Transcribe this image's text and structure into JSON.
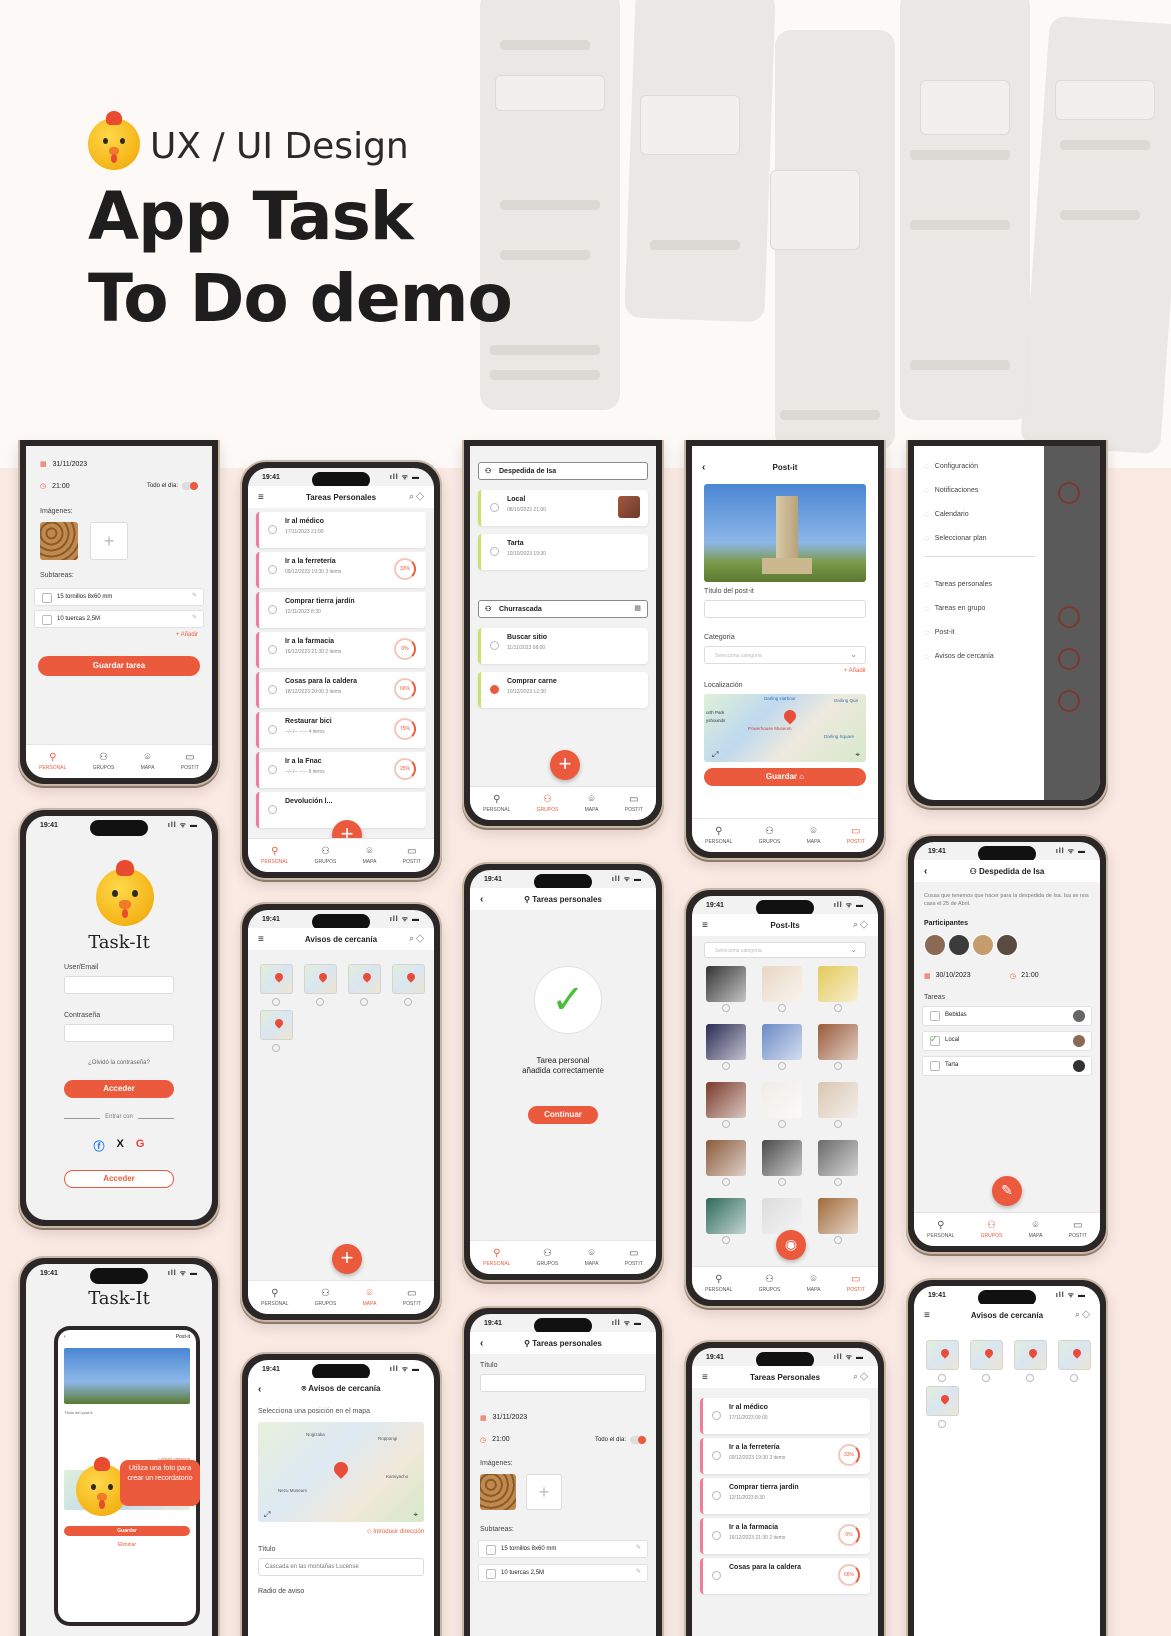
{
  "hero": {
    "subtitle": "UX / UI Design",
    "title_line1": "App Task",
    "title_line2": "To Do demo"
  },
  "status": {
    "time": "19:41",
    "icons": "ıll ᯤ ▬"
  },
  "nav": {
    "personal": "PERSONAL",
    "grupos": "GRUPOS",
    "mapa": "MAPA",
    "postit": "POSTIT"
  },
  "p1": {
    "date": "31/11/2023",
    "time": "21:00",
    "allday": "Todo el día:",
    "images_label": "Imágenes:",
    "subtasks_label": "Subtareas:",
    "subtasks": [
      "15 tornillos 8x60 mm",
      "10 tuercas 2,5M"
    ],
    "add": "+ Añadir",
    "save": "Guardar tarea"
  },
  "p2": {
    "title": "Tareas Personales",
    "tasks": [
      {
        "name": "Ir al médico",
        "meta": "17/11/2023   21:00",
        "pct": ""
      },
      {
        "name": "Ir a la ferretería",
        "meta": "09/12/2023   19:30   3 items",
        "pct": "33%"
      },
      {
        "name": "Comprar tierra jardín",
        "meta": "12/11/2023   8:30",
        "pct": ""
      },
      {
        "name": "Ir a la farmacia",
        "meta": "16/12/2023   21:30   2 items",
        "pct": "0%"
      },
      {
        "name": "Cosas para la caldera",
        "meta": "18/12/2023   20:00   3 items",
        "pct": "66%"
      },
      {
        "name": "Restaurar bici",
        "meta": "--/--/--   --:--   4 items",
        "pct": "75%"
      },
      {
        "name": "Ir a la Fnac",
        "meta": "--/--/--   --:--   8 items",
        "pct": "25%"
      },
      {
        "name": "Devolución l...",
        "meta": "",
        "pct": ""
      }
    ]
  },
  "p3": {
    "group1": "Despedida de Isa",
    "g1_tasks": [
      {
        "name": "Local",
        "meta": "08/10/2023   21:00"
      },
      {
        "name": "Tarta",
        "meta": "10/10/2023   19:30"
      }
    ],
    "group2": "Churrascada",
    "g2_tasks": [
      {
        "name": "Buscar sitio",
        "meta": "11/11/2023   08:00"
      },
      {
        "name": "Comprar carne",
        "meta": "10/12/2023   12:30"
      }
    ]
  },
  "p4": {
    "title": "Post-it",
    "title_label": "Título del post-it",
    "category_label": "Categoría",
    "category_placeholder": "Selecciona categoría",
    "add": "+ Añadir",
    "location_label": "Localización",
    "map_labels": [
      "Darling Harbour",
      "Darling Qua",
      "Powerhouse Museum",
      "Darling Square",
      "orth Park",
      "yshounds"
    ],
    "save": "Guardar"
  },
  "p5": {
    "menu_top": [
      "Configuración",
      "Notificaciones",
      "Calendario",
      "Seleccionar plan"
    ],
    "menu_bottom": [
      "Tareas personales",
      "Tareas en grupo",
      "Post-it",
      "Avisos de cercanía"
    ]
  },
  "p6": {
    "app_name": "Task-It",
    "user_label": "User/Email",
    "pass_label": "Contraseña",
    "forgot": "¿Olvidó la contraseña?",
    "login": "Acceder",
    "divider": "Entrar con",
    "login2": "Acceder"
  },
  "p7": {
    "title": "Avisos de cercanía"
  },
  "p8": {
    "title": "Tareas personales",
    "msg1": "Tarea personal",
    "msg2": "añadida correctamente",
    "btn": "Continuar"
  },
  "p9": {
    "title": "Post-Its",
    "placeholder": "Selecciona categoría"
  },
  "p10": {
    "title": "Despedida de Isa",
    "desc": "Cosas que tenemos que hacer para la despedida de Isa. Isa se nos casa el 25 de Abril.",
    "participants": "Participantes",
    "date": "30/10/2023",
    "time": "21:00",
    "tasks_label": "Tareas",
    "tasks": [
      "Bebidas",
      "Local",
      "Tarta"
    ]
  },
  "p11": {
    "app_name": "Task-It",
    "callout": "Utiliza una foto para crear un recordatorio",
    "inner_title": "Post-it",
    "inner_label": "Título del post-it",
    "inner_add": "+ Añadir categoría",
    "inner_save": "Guardar",
    "inner_delete": "Eliminar"
  },
  "p12": {
    "title": "Avisos de cercanía",
    "instruction": "Selecciona una posición en el mapa",
    "map_labels": [
      "Nogizaka",
      "Roppongi",
      "Nezu Museum",
      "Kamiyacho"
    ],
    "address_link": "◇ Introducir dirección",
    "title_label": "Título",
    "title_value": "Cascada en las montañas Lucense",
    "radius_label": "Radio de aviso"
  },
  "p13": {
    "title": "Tareas personales",
    "title_label": "Título",
    "date": "31/11/2023",
    "time": "21:00",
    "allday": "Todo el día:",
    "images_label": "Imágenes:",
    "subtasks_label": "Subtareas:",
    "subtasks": [
      "15 tornillos 8x60 mm",
      "10 tuercas 2,5M"
    ]
  },
  "p14": {
    "title": "Tareas Personales",
    "tasks": [
      {
        "name": "Ir al médico",
        "meta": "17/11/2023   09:00",
        "pct": ""
      },
      {
        "name": "Ir a la ferretería",
        "meta": "09/12/2023   19:30   3 items",
        "pct": "33%"
      },
      {
        "name": "Comprar tierra jardín",
        "meta": "12/11/2023   8:30",
        "pct": ""
      },
      {
        "name": "Ir a la farmacia",
        "meta": "16/12/2023   21:30   2 items",
        "pct": "0%"
      },
      {
        "name": "Cosas para la caldera",
        "meta": "",
        "pct": "66%"
      }
    ]
  },
  "p15": {
    "title": "Avisos de cercanía"
  },
  "colors": {
    "accent": "#ec5a3d",
    "pink": "#ef7e9c",
    "lime": "#c5e46b",
    "bg": "#fbe9e3"
  }
}
